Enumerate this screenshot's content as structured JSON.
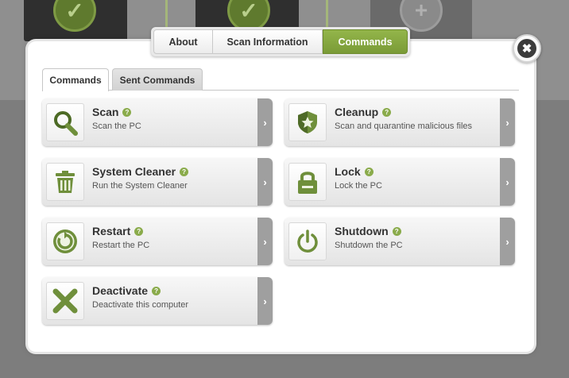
{
  "top_tabs": [
    {
      "label": "About"
    },
    {
      "label": "Scan Information"
    },
    {
      "label": "Commands",
      "active": true
    }
  ],
  "sub_tabs": [
    {
      "label": "Commands",
      "active": true
    },
    {
      "label": "Sent Commands"
    }
  ],
  "close_icon": "close-icon",
  "help_glyph": "?",
  "arrow_glyph": "›",
  "commands": [
    {
      "title": "Scan",
      "desc": "Scan the PC",
      "icon": "magnifier-icon"
    },
    {
      "title": "Cleanup",
      "desc": "Scan and quarantine malicious files",
      "icon": "shield-star-icon"
    },
    {
      "title": "System Cleaner",
      "desc": "Run the System Cleaner",
      "icon": "trash-icon"
    },
    {
      "title": "Lock",
      "desc": "Lock the PC",
      "icon": "padlock-icon"
    },
    {
      "title": "Restart",
      "desc": "Restart the PC",
      "icon": "restart-icon"
    },
    {
      "title": "Shutdown",
      "desc": "Shutdown the PC",
      "icon": "power-icon"
    },
    {
      "title": "Deactivate",
      "desc": "Deactivate this computer",
      "icon": "x-mark-icon"
    }
  ],
  "colors": {
    "accent": "#7a9b37",
    "icon_green": "#6f8f3b",
    "overlay": "#7d7d7d"
  }
}
